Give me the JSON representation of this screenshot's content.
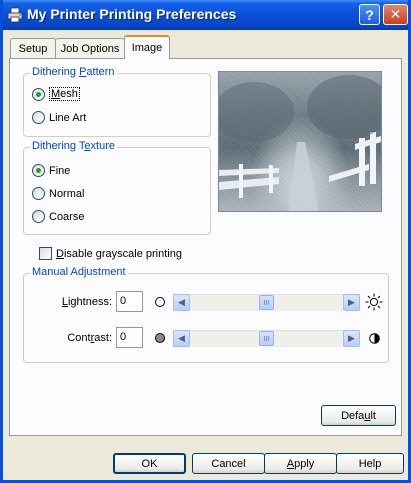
{
  "window": {
    "title": "My Printer Printing Preferences",
    "help_glyph": "?",
    "close_glyph": "✕"
  },
  "tabs": [
    {
      "label": "Setup",
      "active": false
    },
    {
      "label": "Job Options",
      "active": false
    },
    {
      "label": "Image",
      "active": true
    }
  ],
  "dithering_pattern": {
    "legend_pre": "Dithering ",
    "legend_key": "P",
    "legend_post": "attern",
    "options": [
      {
        "label_key": "M",
        "label_post": "esh",
        "checked": true
      },
      {
        "label": "Line Art",
        "checked": false
      }
    ]
  },
  "dithering_texture": {
    "legend_pre": "Dithering T",
    "legend_key": "e",
    "legend_post": "xture",
    "options": [
      {
        "label": "Fine",
        "checked": true
      },
      {
        "label": "Normal",
        "checked": false
      },
      {
        "label": "Coarse",
        "checked": false
      }
    ]
  },
  "grayscale": {
    "label_key": "D",
    "label_post": "isable grayscale printing",
    "checked": false
  },
  "manual_adjustment": {
    "legend": "Manual Adjustment",
    "lightness": {
      "label_key": "L",
      "label_post": "ightness:",
      "value": "0",
      "level": 0.5
    },
    "contrast": {
      "label_pre": "Cont",
      "label_key": "r",
      "label_post": "ast:",
      "value": "0",
      "level": 0.5
    }
  },
  "default_button": {
    "pre": "Defa",
    "key": "u",
    "post": "lt"
  },
  "footer": {
    "ok": "OK",
    "cancel": "Cancel",
    "apply_key": "A",
    "apply_post": "pply",
    "help": "Help"
  },
  "icons": {
    "arrow_left": "◀",
    "arrow_right": "▶"
  },
  "colors": {
    "title_blue": "#0a50d8",
    "legend_blue": "#0046d5",
    "radio_green": "#21a121",
    "tab_highlight": "#e68b2c"
  }
}
